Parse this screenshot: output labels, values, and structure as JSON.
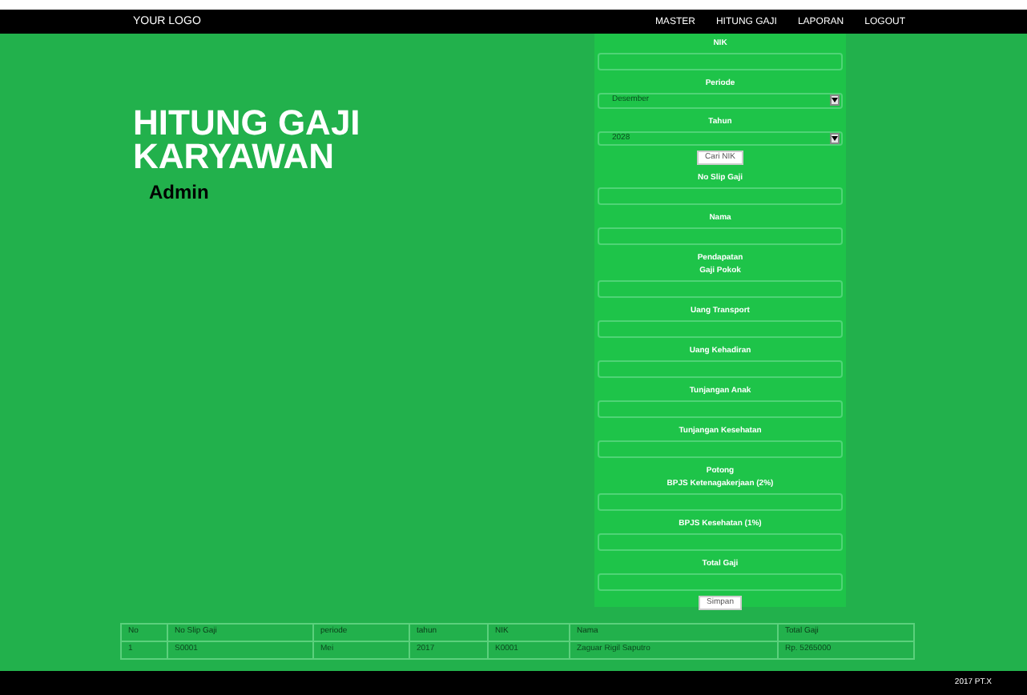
{
  "navbar": {
    "logo": "YOUR LOGO",
    "menu": [
      "MASTER",
      "HITUNG GAJI",
      "LAPORAN",
      "LOGOUT"
    ]
  },
  "hero": {
    "title_lines": [
      "HITUNG GAJI",
      "KARYAWAN"
    ],
    "subtitle": "Admin"
  },
  "form": [
    {
      "kind": "label",
      "text": "NIK"
    },
    {
      "kind": "input"
    },
    {
      "kind": "label",
      "text": "Periode"
    },
    {
      "kind": "select",
      "value": "Desember"
    },
    {
      "kind": "label",
      "text": "Tahun"
    },
    {
      "kind": "select",
      "value": "2028"
    },
    {
      "kind": "button",
      "text": "Cari NIK"
    },
    {
      "kind": "label",
      "text": "No Slip Gaji"
    },
    {
      "kind": "input"
    },
    {
      "kind": "label",
      "text": "Nama"
    },
    {
      "kind": "input"
    },
    {
      "kind": "label",
      "text": "Pendapatan"
    },
    {
      "kind": "label",
      "text": "Gaji Pokok"
    },
    {
      "kind": "input"
    },
    {
      "kind": "label",
      "text": "Uang Transport"
    },
    {
      "kind": "input"
    },
    {
      "kind": "label",
      "text": "Uang Kehadiran"
    },
    {
      "kind": "input"
    },
    {
      "kind": "label",
      "text": "Tunjangan Anak"
    },
    {
      "kind": "input"
    },
    {
      "kind": "label",
      "text": "Tunjangan Kesehatan"
    },
    {
      "kind": "input"
    },
    {
      "kind": "label",
      "text": "Potong"
    },
    {
      "kind": "label",
      "text": "BPJS Ketenagakerjaan (2%)"
    },
    {
      "kind": "input"
    },
    {
      "kind": "label",
      "text": "BPJS Kesehatan (1%)"
    },
    {
      "kind": "input"
    },
    {
      "kind": "label",
      "text": "Total Gaji"
    },
    {
      "kind": "input"
    },
    {
      "kind": "button",
      "text": "Simpan"
    }
  ],
  "table": {
    "columns": [
      "No",
      "No Slip Gaji",
      "periode",
      "tahun",
      "NIK",
      "Nama",
      "Total Gaji"
    ],
    "rows": [
      [
        "1",
        "S0001",
        "Mei",
        "2017",
        "K0001",
        "Zaguar Rigil Saputro",
        "Rp. 5265000"
      ]
    ]
  },
  "footer": "2017 PT.X"
}
